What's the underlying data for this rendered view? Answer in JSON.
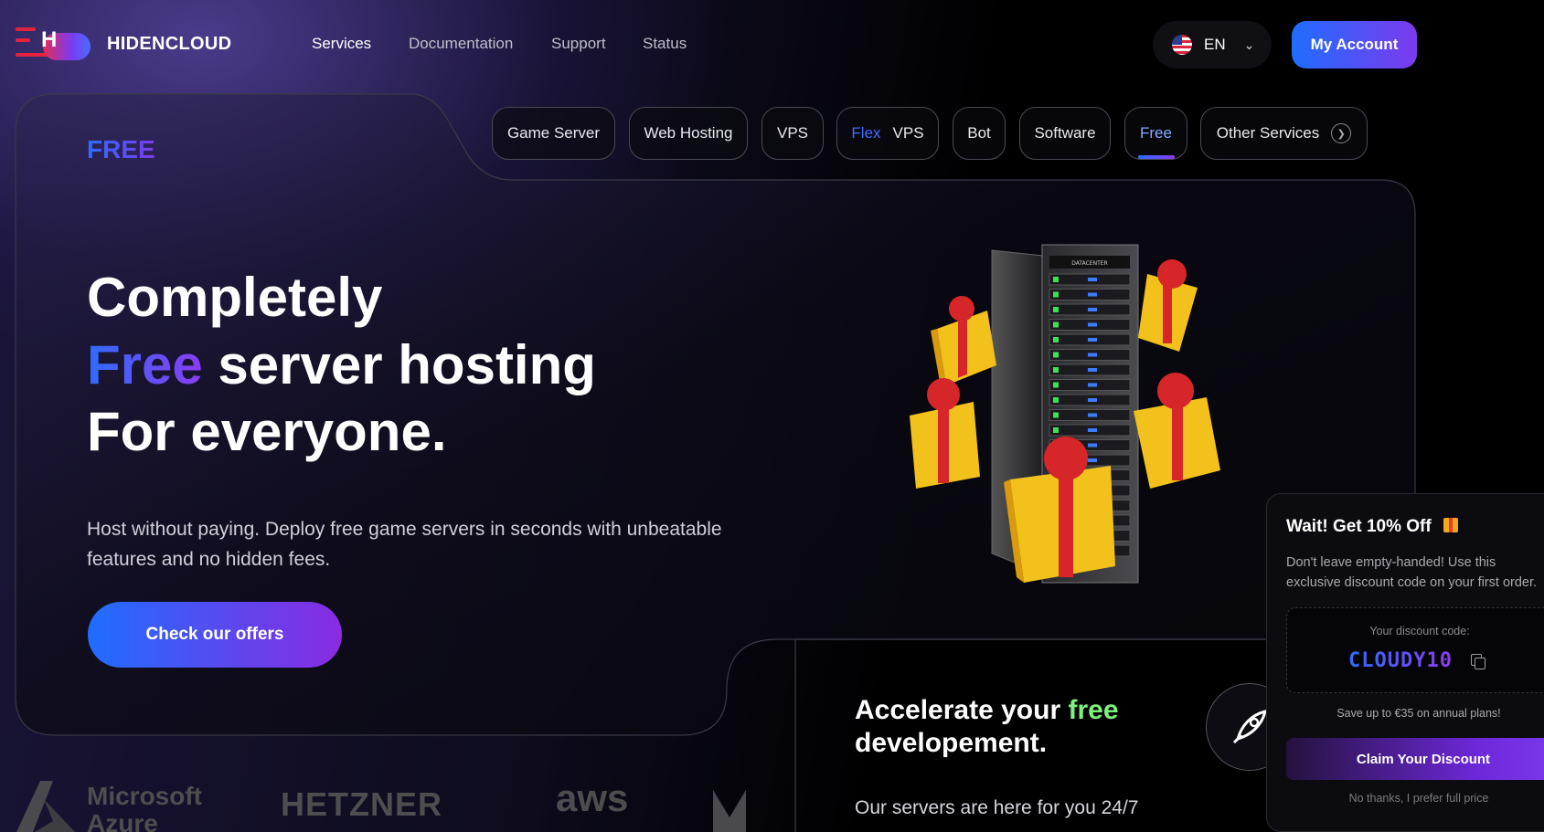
{
  "header": {
    "brand": "HIDENCLOUD",
    "nav": [
      "Services",
      "Documentation",
      "Support",
      "Status"
    ],
    "language": "EN",
    "account_button": "My Account"
  },
  "hero": {
    "tag": "FREE",
    "categories": [
      {
        "label": "Game Server"
      },
      {
        "label": "Web Hosting"
      },
      {
        "label": "VPS"
      },
      {
        "prefix": "Flex",
        "label": "VPS"
      },
      {
        "label": "Bot"
      },
      {
        "label": "Software"
      },
      {
        "label": "Free",
        "active": true
      },
      {
        "label": "Other Services"
      }
    ],
    "headline": {
      "line1": "Completely",
      "line2_accent": "Free",
      "line2_rest": "server hosting",
      "line3": "For everyone."
    },
    "description": "Host without paying. Deploy free game servers in seconds with unbeatable features and no hidden fees.",
    "cta": "Check our offers",
    "illustration_rack_label": "DATACENTER"
  },
  "partners": {
    "azure_line1": "Microsoft",
    "azure_line2": "Azure",
    "hetzner": "HETZNER",
    "aws": "aws"
  },
  "accelerate": {
    "title_part1": "Accelerate your",
    "title_accent": "free",
    "title_part2": "developement.",
    "subtitle": "Our servers are here for you 24/7"
  },
  "popup": {
    "title": "Wait! Get 10% Off",
    "text": "Don't leave empty-handed! Use this exclusive discount code on your first order.",
    "code_label": "Your discount code:",
    "code": "CLOUDY10",
    "save_note": "Save up to €35 on annual plans!",
    "claim_button": "Claim Your Discount",
    "decline_link": "No thanks, I prefer full price"
  },
  "colors": {
    "accent_blue": "#1f6dff",
    "accent_purple": "#8a2be2",
    "accent_green": "#7bf07b",
    "background": "#000000"
  }
}
